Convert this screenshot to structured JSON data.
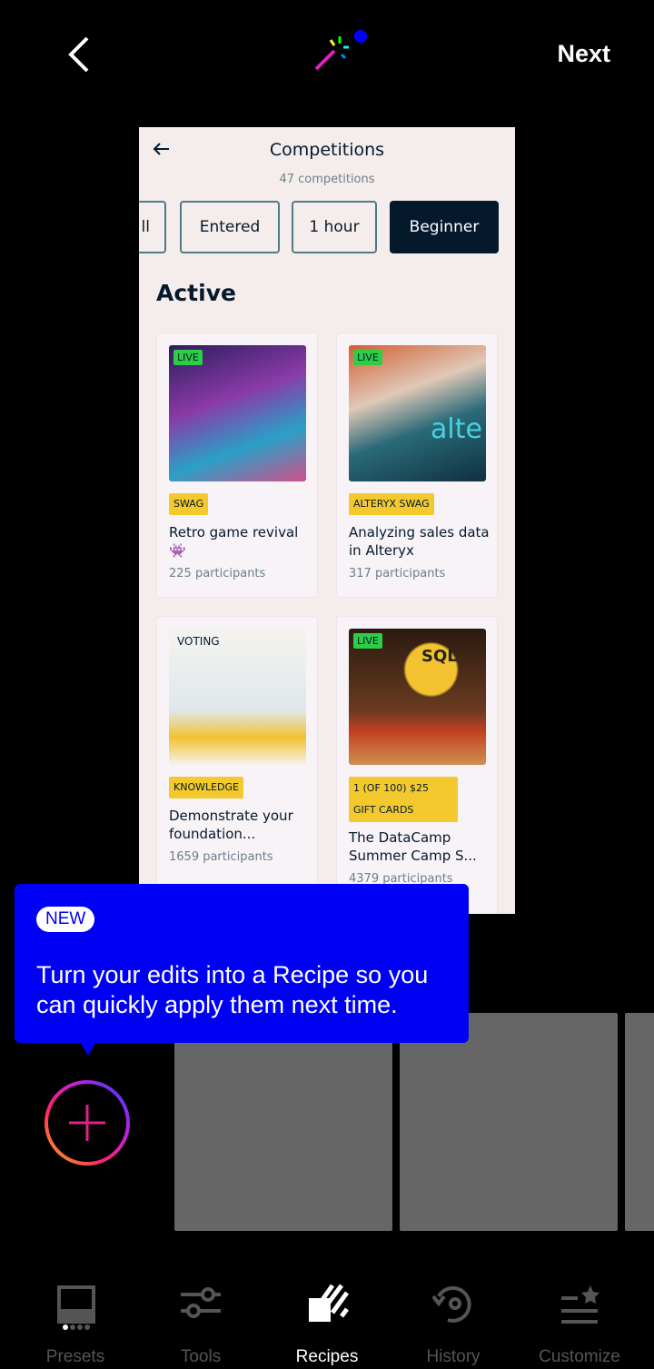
{
  "header": {
    "next_label": "Next",
    "back_icon": "chevron-left-icon",
    "center_icon": "magic-wand-icon"
  },
  "screenshot": {
    "title": "Competitions",
    "subtitle": "47 competitions",
    "filters": [
      {
        "label": "ll"
      },
      {
        "label": "Entered"
      },
      {
        "label": "1 hour"
      },
      {
        "label": "Beginner",
        "selected": true
      }
    ],
    "section": "Active",
    "cards": [
      {
        "badge": "LIVE",
        "tag": "SWAG",
        "title": "Retro game revival 👾",
        "participants": "225 participants"
      },
      {
        "badge": "LIVE",
        "tag": "ALTERYX SWAG",
        "title": "Analyzing sales data in Alteryx",
        "participants": "317 participants",
        "image_text": "alte"
      },
      {
        "badge": "VOTING",
        "tag": "KNOWLEDGE",
        "title": "Demonstrate your foundation...",
        "participants": "1659 participants"
      },
      {
        "badge": "LIVE",
        "tag": "1 (OF 100) $25 GIFT CARDS",
        "title": "The DataCamp Summer Camp S...",
        "participants": "4379 participants",
        "image_text": "SQL"
      }
    ]
  },
  "tooltip": {
    "badge": "NEW",
    "message": "Turn your edits into a Recipe so you can quickly apply them next time."
  },
  "nav": [
    {
      "label": "Presets"
    },
    {
      "label": "Tools"
    },
    {
      "label": "Recipes",
      "active": true
    },
    {
      "label": "History"
    },
    {
      "label": "Customize"
    }
  ],
  "colors": {
    "tooltip": "#0000f5",
    "tile": "#666666",
    "active": "#ffffff",
    "inactive": "#555555"
  }
}
